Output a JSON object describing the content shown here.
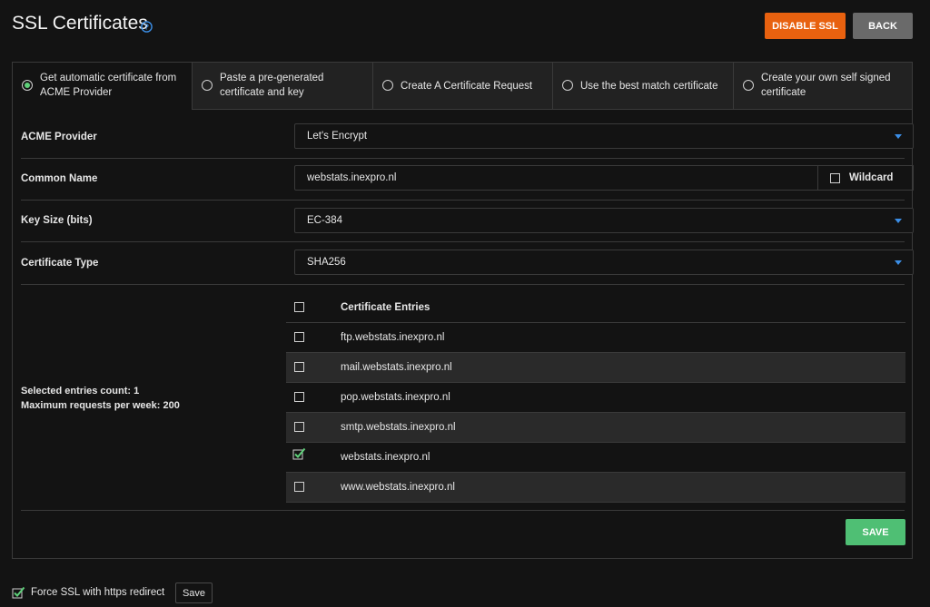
{
  "header": {
    "title": "SSL Certificates",
    "disable_ssl": "DISABLE SSL",
    "back": "BACK"
  },
  "tabs": [
    {
      "label": "Get automatic certificate from ACME Provider",
      "selected": true
    },
    {
      "label": "Paste a pre-generated certificate and key",
      "selected": false
    },
    {
      "label": "Create A Certificate Request",
      "selected": false
    },
    {
      "label": "Use the best match certificate",
      "selected": false
    },
    {
      "label": "Create your own self signed certificate",
      "selected": false
    }
  ],
  "form": {
    "acme_provider": {
      "label": "ACME Provider",
      "value": "Let's Encrypt"
    },
    "common_name": {
      "label": "Common Name",
      "value": "webstats.inexpro.nl",
      "wildcard_label": "Wildcard",
      "wildcard_checked": false
    },
    "key_size": {
      "label": "Key Size (bits)",
      "value": "EC-384"
    },
    "certificate_type": {
      "label": "Certificate Type",
      "value": "SHA256"
    }
  },
  "entries": {
    "header": "Certificate Entries",
    "rows": [
      {
        "name": "ftp.webstats.inexpro.nl",
        "checked": false
      },
      {
        "name": "mail.webstats.inexpro.nl",
        "checked": false
      },
      {
        "name": "pop.webstats.inexpro.nl",
        "checked": false
      },
      {
        "name": "smtp.webstats.inexpro.nl",
        "checked": false
      },
      {
        "name": "webstats.inexpro.nl",
        "checked": true
      },
      {
        "name": "www.webstats.inexpro.nl",
        "checked": false
      }
    ],
    "selected_count": "Selected entries count: 1",
    "max_requests": "Maximum requests per week: 200"
  },
  "save_label": "SAVE",
  "footer": {
    "force_ssl_label": "Force SSL with https redirect",
    "force_ssl_checked": true,
    "save_label": "Save"
  },
  "colors": {
    "accent_orange": "#e8610f",
    "accent_green": "#4fbf74",
    "check_green": "#5fd07a",
    "caret_blue": "#3b8ee6",
    "background": "#131313"
  }
}
